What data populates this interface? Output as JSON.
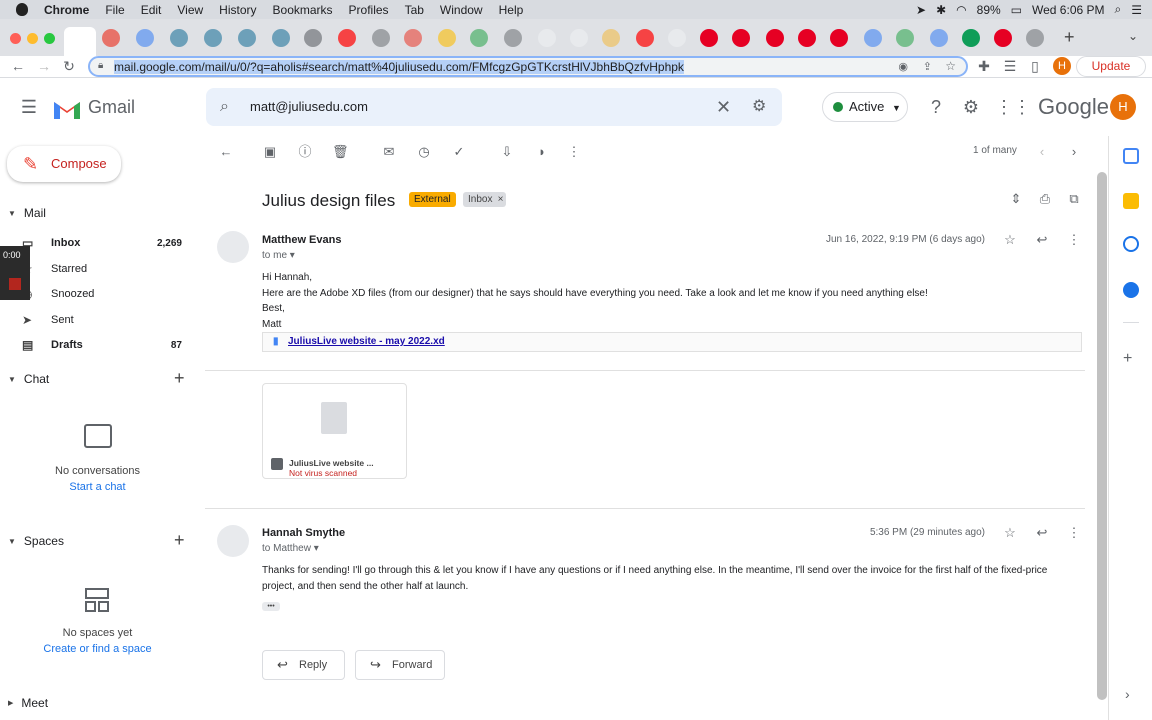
{
  "menubar": {
    "app": "Chrome",
    "items": [
      "File",
      "Edit",
      "View",
      "History",
      "Bookmarks",
      "Profiles",
      "Tab",
      "Window",
      "Help"
    ],
    "battery": "89%",
    "datetime": "Wed 6:06 PM"
  },
  "browser": {
    "url_prefix": "mail.google.com/mail/u/0/?q=aholis#search/matt%40juliusedu.com/FMfcgzGpGTKcrstHlVJbhBbQzfvHphpk",
    "update_label": "Update",
    "profile_initial": "H"
  },
  "header": {
    "app_name": "Gmail",
    "search_value": "matt@juliusedu.com",
    "status": "Active",
    "brand": "Google",
    "avatar_initial": "H"
  },
  "sidebar": {
    "compose": "Compose",
    "mail_section": "Mail",
    "items": [
      {
        "label": "Inbox",
        "count": "2,269"
      },
      {
        "label": "Starred",
        "count": ""
      },
      {
        "label": "Snoozed",
        "count": ""
      },
      {
        "label": "Sent",
        "count": ""
      },
      {
        "label": "Drafts",
        "count": "87"
      }
    ],
    "chat_section": "Chat",
    "no_conversations": "No conversations",
    "start_chat": "Start a chat",
    "spaces_section": "Spaces",
    "no_spaces": "No spaces yet",
    "create_space": "Create or find a space",
    "meet_section": "Meet",
    "timer": "0:00"
  },
  "toolbar": {
    "pagination": "1 of many"
  },
  "thread": {
    "subject": "Julius design files",
    "labels": [
      "External",
      "Inbox"
    ],
    "messages": [
      {
        "sender": "Matthew Evans",
        "to": "to me",
        "date": "Jun 16, 2022, 9:19 PM (6 days ago)",
        "lines": [
          "Hi Hannah,",
          "Here are the Adobe XD files (from our designer) that he says should have everything you need.  Take a look and let me know if you need anything else!",
          "Best,",
          "Matt"
        ],
        "attachment_link": "JuliusLive website - may 2022.xd",
        "attachment_card_name": "JuliusLive website ...",
        "attachment_card_status": "Not virus scanned"
      },
      {
        "sender": "Hannah Smythe",
        "to": "to Matthew",
        "date": "5:36 PM (29 minutes ago)",
        "lines": [
          "Thanks for sending! I'll go through this & let you know if I have any questions or if I need anything else. In the meantime, I'll send over the invoice for the first half of the fixed-price",
          "project, and then send the other half at launch."
        ],
        "more": "•••"
      }
    ],
    "reply_label": "Reply",
    "forward_label": "Forward"
  }
}
